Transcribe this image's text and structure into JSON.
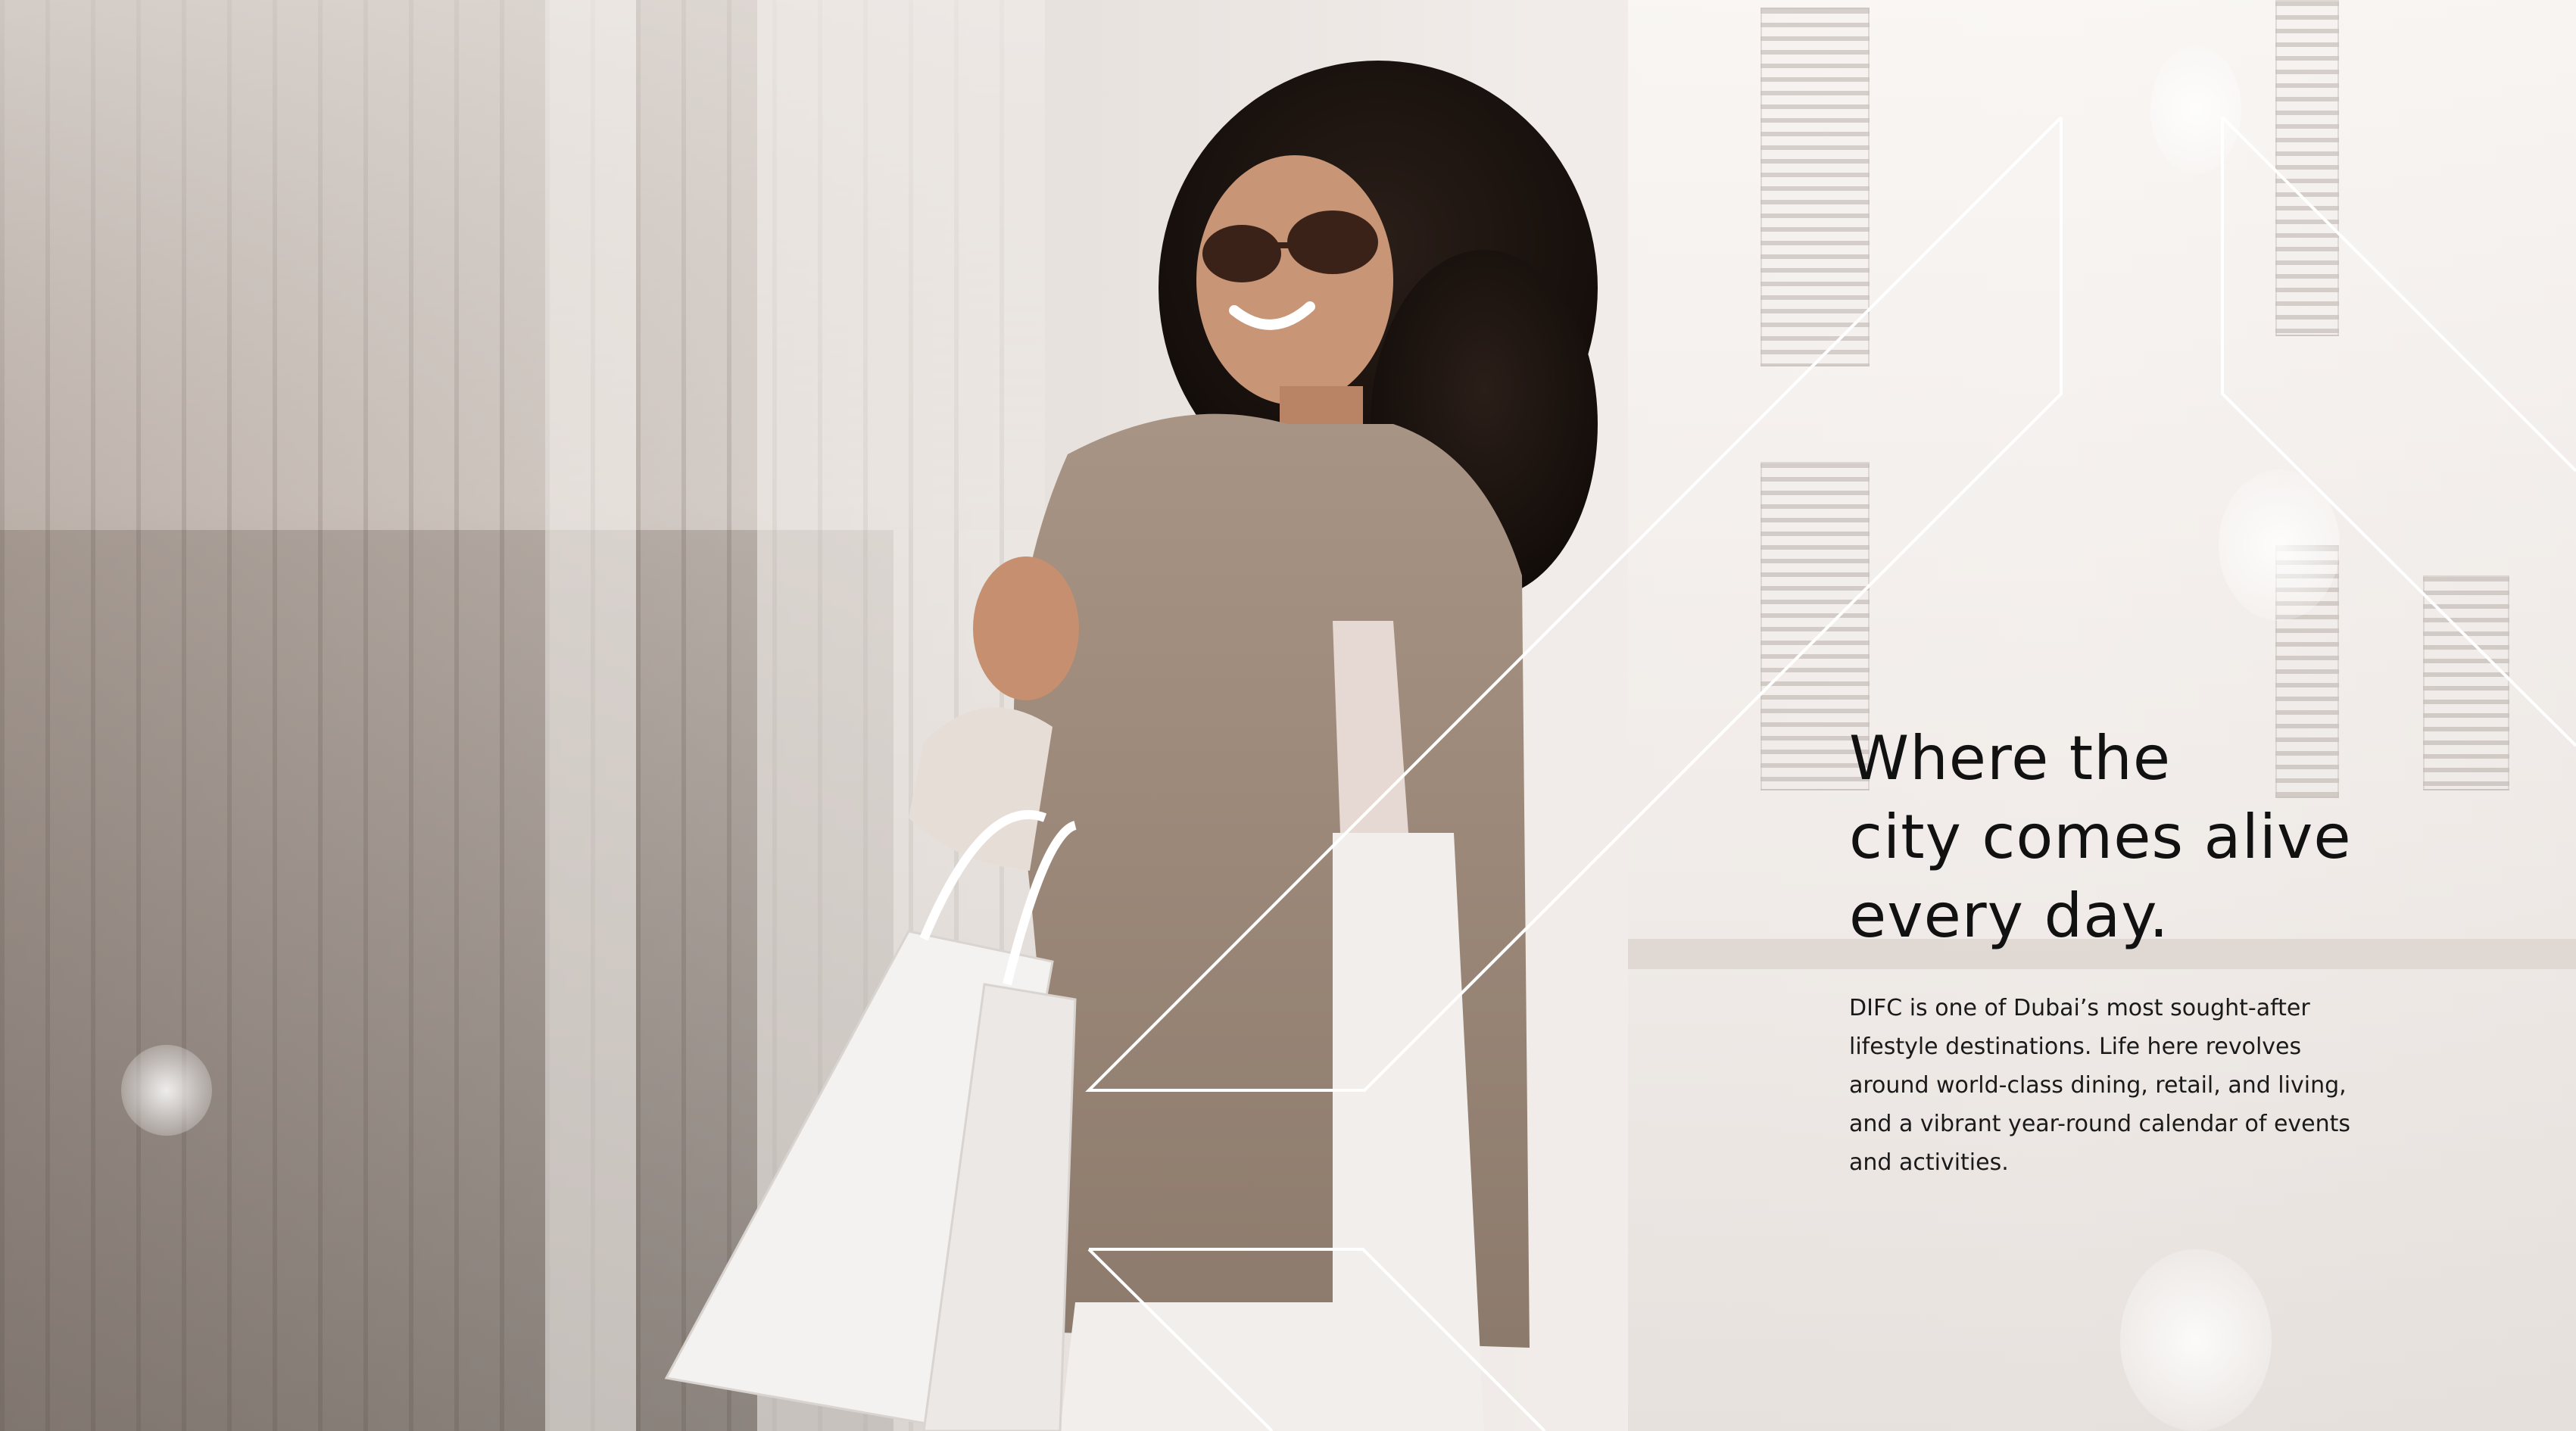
{
  "headline": {
    "line1": "Where the",
    "line2": "city comes alive",
    "line3": "every day."
  },
  "body": {
    "line1": "DIFC is one of Dubai’s most sought-after",
    "line2": "lifestyle destinations. Life here revolves",
    "line3": "around world-class dining, retail, and living,",
    "line4": "and a vibrant year-round calendar of events",
    "line5": "and activities."
  },
  "colors": {
    "text": "#111111",
    "line": "#ffffff",
    "background": "#ece7e3"
  }
}
